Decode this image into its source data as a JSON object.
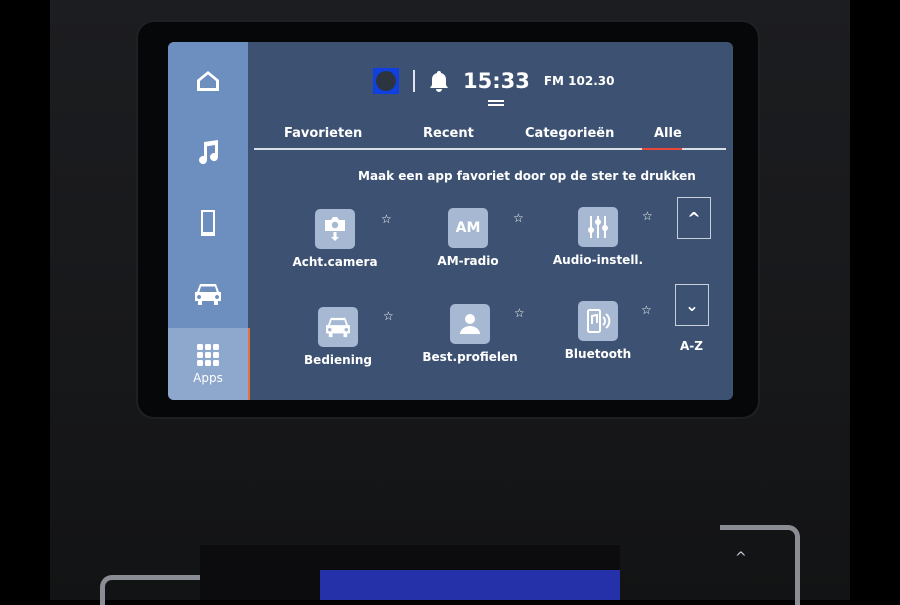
{
  "status_bar": {
    "time": "15:33",
    "radio": "FM 102.30",
    "app_icon": "profile-app-icon",
    "notification_icon": "bell-icon"
  },
  "sidebar": {
    "items": [
      {
        "icon": "home-icon"
      },
      {
        "icon": "music-icon"
      },
      {
        "icon": "phone-icon"
      },
      {
        "icon": "car-icon"
      },
      {
        "icon": "apps-grid-icon",
        "label": "Apps",
        "active": true
      }
    ]
  },
  "tabs": [
    {
      "label": "Favorieten"
    },
    {
      "label": "Recent"
    },
    {
      "label": "Categorieën"
    },
    {
      "label": "Alle",
      "active": true
    }
  ],
  "hint": "Maak een app favoriet door op de ster te drukken",
  "apps": [
    {
      "label": "Acht.camera",
      "icon": "rear-camera-icon",
      "favorite": false
    },
    {
      "label": "AM-radio",
      "icon_text": "AM",
      "favorite": false
    },
    {
      "label": "Audio-instell.",
      "icon": "equalizer-icon",
      "favorite": false
    },
    {
      "label": "Bediening",
      "icon": "car-icon",
      "favorite": false
    },
    {
      "label": "Best.profielen",
      "icon": "user-profile-icon",
      "favorite": false
    },
    {
      "label": "Bluetooth",
      "icon": "bluetooth-phone-icon",
      "favorite": false
    }
  ],
  "scroll": {
    "up_icon": "chevron-up-icon",
    "down_icon": "chevron-down-icon",
    "sort_label": "A-Z"
  },
  "colors": {
    "screen_bg": "#3d5272",
    "sidebar_bg": "#6d8fbf",
    "sidebar_active": "#8ea7cc",
    "accent": "#e8483a"
  }
}
